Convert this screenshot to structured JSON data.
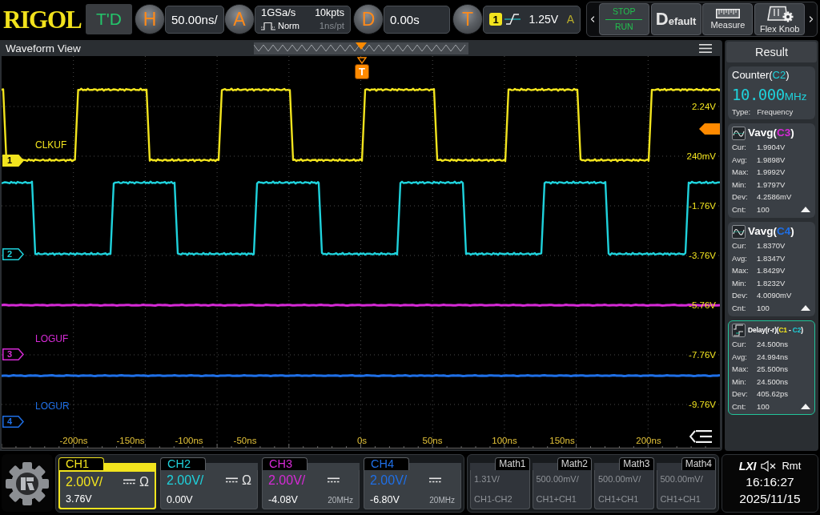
{
  "top_bar": {
    "brand": "RIGOL",
    "mode": "T'D",
    "horizontal": {
      "key": "H",
      "scale": "50.00ns/"
    },
    "acquire": {
      "key": "A",
      "sample_rate": "1GSa/s",
      "mode": "Norm",
      "memory_depth": "10kpts",
      "resolution": "1ns/pt"
    },
    "delay": {
      "key": "D",
      "offset": "0.00s"
    },
    "trigger": {
      "key": "T",
      "source": "1",
      "level": "1.25V",
      "sweep": "A"
    },
    "tools": [
      {
        "kind": "run_stop",
        "label": "STOP",
        "secondary_label": "RUN"
      },
      {
        "kind": "default",
        "label": "Default"
      },
      {
        "kind": "measure",
        "label": "Measure"
      },
      {
        "kind": "flex_knob",
        "label": "Flex Knob"
      }
    ]
  },
  "waveform_view": {
    "title": "Waveform View",
    "trigger_marker": "T",
    "traces": [
      {
        "marker": "1",
        "label": "CLKUF",
        "kind": "square",
        "color": "#f2e41e",
        "selected": true
      },
      {
        "marker": "2",
        "kind": "square",
        "color": "#1fd2dc",
        "selected": false
      },
      {
        "marker": "3",
        "label": "LOGUF",
        "kind": "flat",
        "color": "#d62ad6",
        "selected": false
      },
      {
        "marker": "4",
        "label": "LOGUR",
        "kind": "flat",
        "color": "#1f6fe6",
        "selected": false
      }
    ],
    "voltage_labels": [
      "2.24V",
      "240mV",
      "-1.76V",
      "-3.76V",
      "-5.76V",
      "-7.76V",
      "-9.76V"
    ],
    "time_labels": [
      "-200ns",
      "-150ns",
      "-100ns",
      "-50ns",
      "0s",
      "50ns",
      "100ns",
      "150ns",
      "200ns"
    ]
  },
  "result_panel": {
    "title": "Result",
    "measurements": [
      {
        "kind": "counter",
        "title_parts": [
          {
            "text": "Counter("
          },
          {
            "text": "C2",
            "color": "#1fd2dc"
          },
          {
            "text": ")"
          }
        ],
        "value": "10.000",
        "unit": "MHz",
        "type_label": "Type:",
        "type_value": "Frequency",
        "selected": false
      },
      {
        "kind": "vavg",
        "title_parts": [
          {
            "text": "Vavg("
          },
          {
            "text": "C3",
            "color": "#d62ad6"
          },
          {
            "text": ")"
          }
        ],
        "rows": [
          {
            "label": "Cur:",
            "value": "1.9904V"
          },
          {
            "label": "Avg:",
            "value": "1.9898V"
          },
          {
            "label": "Max:",
            "value": "1.9992V"
          },
          {
            "label": "Min:",
            "value": "1.9797V"
          },
          {
            "label": "Dev:",
            "value": "4.2586mV"
          },
          {
            "label": "Cnt:",
            "value": "100"
          }
        ],
        "selected": false
      },
      {
        "kind": "vavg",
        "title_parts": [
          {
            "text": "Vavg("
          },
          {
            "text": "C4",
            "color": "#1f6fe6"
          },
          {
            "text": ")"
          }
        ],
        "rows": [
          {
            "label": "Cur:",
            "value": "1.8370V"
          },
          {
            "label": "Avg:",
            "value": "1.8347V"
          },
          {
            "label": "Max:",
            "value": "1.8429V"
          },
          {
            "label": "Min:",
            "value": "1.8232V"
          },
          {
            "label": "Dev:",
            "value": "4.0090mV"
          },
          {
            "label": "Cnt:",
            "value": "100"
          }
        ],
        "selected": false
      },
      {
        "kind": "delay",
        "title_parts": [
          {
            "text": "Delay(r-r)("
          },
          {
            "text": "C1",
            "color": "#f2e41e"
          },
          {
            "text": " - "
          },
          {
            "text": "C2",
            "color": "#1fd2dc"
          },
          {
            "text": ")"
          }
        ],
        "rows": [
          {
            "label": "Cur:",
            "value": "24.500ns"
          },
          {
            "label": "Avg:",
            "value": "24.994ns"
          },
          {
            "label": "Max:",
            "value": "25.500ns"
          },
          {
            "label": "Min:",
            "value": "24.500ns"
          },
          {
            "label": "Dev:",
            "value": "405.62ps"
          },
          {
            "label": "Cnt:",
            "value": "100"
          }
        ],
        "selected": true
      }
    ]
  },
  "channels": [
    {
      "label": "CH1",
      "color": "#f2e41e",
      "scale": "2.00V/",
      "offset": "3.76V",
      "impedance": "Ω",
      "selected": true
    },
    {
      "label": "CH2",
      "color": "#1fd2dc",
      "scale": "2.00V/",
      "offset": "0.00V",
      "impedance": "Ω",
      "selected": false
    },
    {
      "label": "CH3",
      "color": "#d62ad6",
      "scale": "2.00V/",
      "offset": "-4.08V",
      "bandwidth_limit": "20MHz",
      "selected": false
    },
    {
      "label": "CH4",
      "color": "#1f6fe6",
      "scale": "2.00V/",
      "offset": "-6.80V",
      "bandwidth_limit": "20MHz",
      "selected": false
    }
  ],
  "math": [
    {
      "label": "Math1",
      "scale": "1.31V/",
      "expression": "CH1-CH2",
      "enabled": false
    },
    {
      "label": "Math2",
      "scale": "500.00mV/",
      "expression": "CH1+CH1",
      "enabled": false
    },
    {
      "label": "Math3",
      "scale": "500.00mV/",
      "expression": "CH1+CH1",
      "enabled": false
    },
    {
      "label": "Math4",
      "scale": "500.00mV/",
      "expression": "CH1+CH1",
      "enabled": false
    }
  ],
  "status": {
    "lxi": "LXI",
    "muted": true,
    "remote": "Rmt",
    "time": "16:16:27",
    "date": "2025/11/15"
  }
}
